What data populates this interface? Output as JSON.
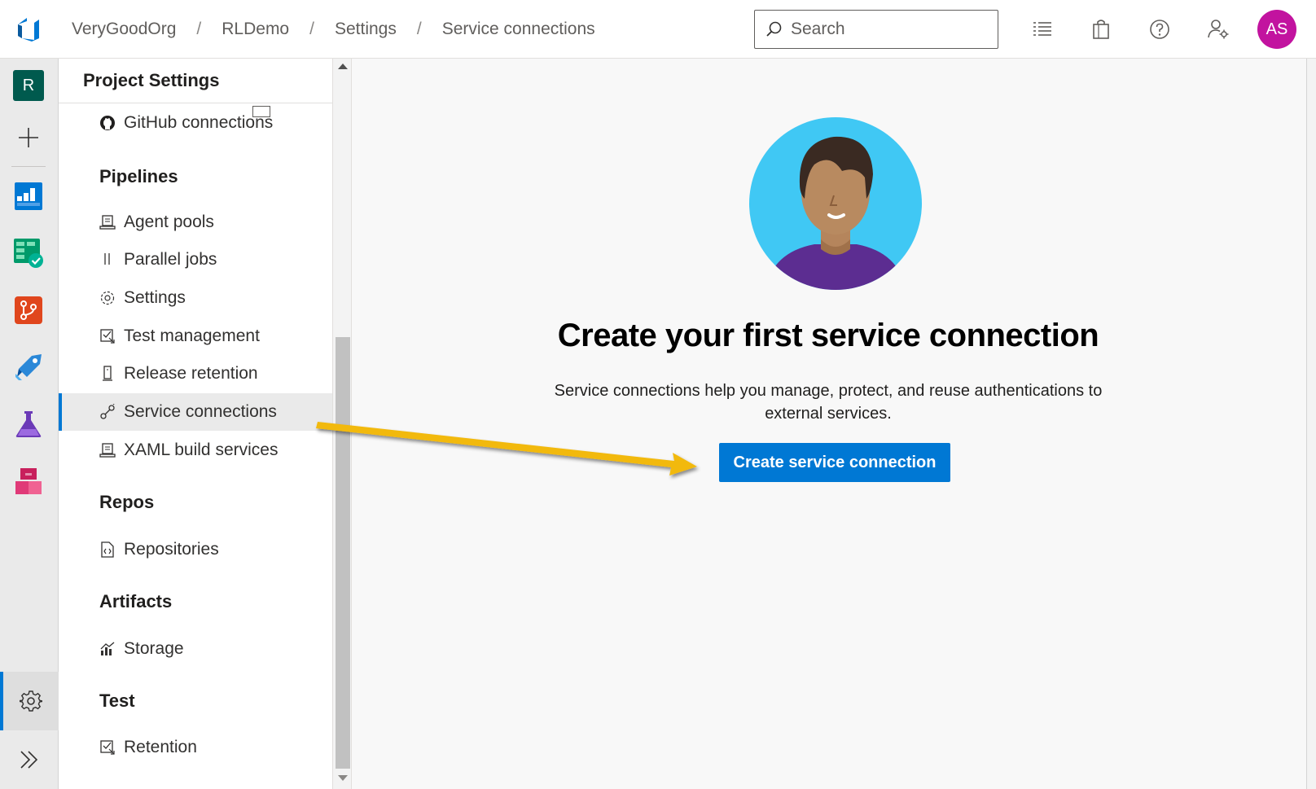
{
  "topbar": {
    "breadcrumbs": [
      "VeryGoodOrg",
      "RLDemo",
      "Settings",
      "Service connections"
    ],
    "separator": "/",
    "search_placeholder": "Search",
    "avatar_initials": "AS",
    "avatar_color": "#c2139f"
  },
  "rail": {
    "project_initial": "R",
    "project_color": "#005a4e",
    "icons": [
      "project-avatar",
      "add-icon",
      "boards-icon",
      "test-plans-icon",
      "repos-icon",
      "pipelines-icon",
      "test-lab-icon",
      "artifacts-icon",
      "settings-icon",
      "expand-icon"
    ]
  },
  "nav": {
    "title": "Project Settings",
    "items": [
      {
        "label": "GitHub connections",
        "icon": "github-icon"
      },
      {
        "label": "Agent pools",
        "icon": "agent-pools-icon"
      },
      {
        "label": "Parallel jobs",
        "icon": "parallel-jobs-icon"
      },
      {
        "label": "Settings",
        "icon": "gear-icon"
      },
      {
        "label": "Test management",
        "icon": "test-management-icon"
      },
      {
        "label": "Release retention",
        "icon": "release-retention-icon"
      },
      {
        "label": "Service connections",
        "icon": "service-connections-icon",
        "selected": true
      },
      {
        "label": "XAML build services",
        "icon": "xaml-build-icon"
      },
      {
        "label": "Repositories",
        "icon": "repositories-icon"
      },
      {
        "label": "Storage",
        "icon": "storage-icon"
      },
      {
        "label": "Retention",
        "icon": "retention-icon"
      }
    ],
    "groups": [
      "Pipelines",
      "Repos",
      "Artifacts",
      "Test"
    ]
  },
  "main": {
    "headline": "Create your first service connection",
    "description": "Service connections help you manage, protect, and reuse authentications to external services.",
    "cta_label": "Create service connection",
    "accent_color": "#0078d4",
    "annotation_arrow_color": "#f2b90f"
  }
}
